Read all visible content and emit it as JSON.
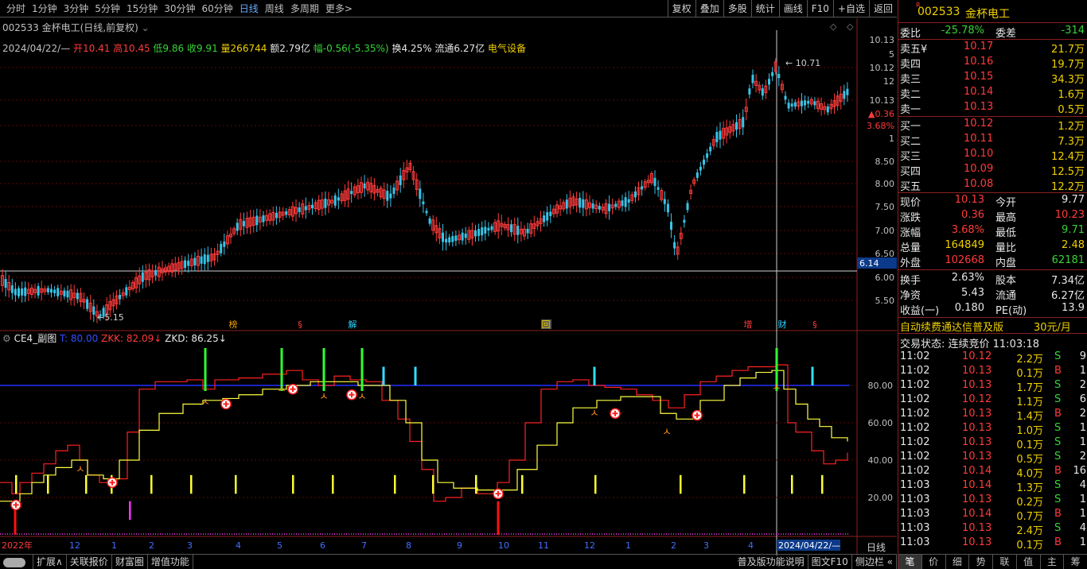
{
  "toolbar": {
    "periods": [
      "分时",
      "1分钟",
      "3分钟",
      "5分钟",
      "15分钟",
      "30分钟",
      "60分钟",
      "日线",
      "周线",
      "多周期",
      "更多>"
    ],
    "active": "日线",
    "right_buttons": [
      "复权",
      "叠加",
      "多股",
      "统计",
      "画线",
      "F10",
      "+自选",
      "返回"
    ]
  },
  "chart": {
    "title": "002533 金杯电工(日线,前复权)",
    "ohlc": {
      "date": "2024/04/22/—",
      "open": "开10.41",
      "high": "高10.45",
      "low": "低9.86",
      "close": "收9.91",
      "vol": "量266744",
      "amt": "额2.79亿",
      "chg": "幅-0.56(-5.35%)",
      "turn": "换4.25%",
      "float": "流通6.27亿",
      "sector": "电气设备"
    },
    "price_labels": [
      "10.13",
      "5",
      "10.12",
      "12",
      "10.13",
      "▲0.36",
      "3.68%",
      "1",
      "8.50",
      "8.00",
      "7.50",
      "7.00",
      "6.50",
      "6.00",
      "5.50"
    ],
    "cross_price": "6.14",
    "high_mark": "10.71",
    "low_mark": "5.15",
    "event_markers": [
      "榜",
      "§",
      "解",
      "回",
      "增",
      "财",
      "§"
    ]
  },
  "indicator": {
    "name": "CE4_副图",
    "t": "T: 80.00",
    "zkk": "ZKK: 82.09↓",
    "zkd": "ZKD: 86.25↓",
    "levels": [
      "80.00",
      "60.00",
      "40.00",
      "20.00"
    ]
  },
  "xaxis": {
    "labels": [
      "2022年",
      "12",
      "1",
      "2",
      "3",
      "4",
      "5",
      "6",
      "7",
      "8",
      "9",
      "10",
      "11",
      "12",
      "1",
      "2",
      "3",
      "4"
    ],
    "cursor_date": "2024/04/22/—",
    "period": "日线"
  },
  "bottom": {
    "tabs": [
      "扩展∧",
      "关联报价",
      "财富圈",
      "增值功能"
    ],
    "right_text": "普及版功能说明",
    "f10": "图文F10",
    "side": "侧边栏 «"
  },
  "quote": {
    "code": "002533",
    "name": "金杯电工",
    "wb": "委比",
    "wb_val": "-25.78%",
    "wc": "委差",
    "wc_val": "-314",
    "sells": [
      {
        "l": "卖五¥",
        "p": "10.17",
        "v": "21.7万"
      },
      {
        "l": "卖四",
        "p": "10.16",
        "v": "19.7万"
      },
      {
        "l": "卖三",
        "p": "10.15",
        "v": "34.3万"
      },
      {
        "l": "卖二",
        "p": "10.14",
        "v": "1.6万"
      },
      {
        "l": "卖一",
        "p": "10.13",
        "v": "0.5万"
      }
    ],
    "buys": [
      {
        "l": "买一",
        "p": "10.12",
        "v": "1.2万"
      },
      {
        "l": "买二",
        "p": "10.11",
        "v": "7.3万"
      },
      {
        "l": "买三",
        "p": "10.10",
        "v": "12.4万"
      },
      {
        "l": "买四",
        "p": "10.09",
        "v": "12.5万"
      },
      {
        "l": "买五",
        "p": "10.08",
        "v": "12.2万"
      }
    ],
    "stats": [
      [
        "现价",
        "10.13",
        "今开",
        "9.77"
      ],
      [
        "涨跌",
        "0.36",
        "最高",
        "10.23"
      ],
      [
        "涨幅",
        "3.68%",
        "最低",
        "9.71"
      ],
      [
        "总量",
        "164849",
        "量比",
        "2.48"
      ],
      [
        "外盘",
        "102668",
        "内盘",
        "62181"
      ]
    ],
    "stats2": [
      [
        "换手",
        "2.63%",
        "股本",
        "7.34亿"
      ],
      [
        "净资",
        "5.43",
        "流通",
        "6.27亿"
      ],
      [
        "收益(一)",
        "0.180",
        "PE(动)",
        "13.9"
      ]
    ],
    "promo": "自动续费通达信普及版",
    "price": "30元/月",
    "status": "交易状态: 连续竞价 11:03:18",
    "ticks": [
      [
        "11:02",
        "10.12",
        "2.2万",
        "S",
        "9"
      ],
      [
        "11:02",
        "10.13",
        "0.1万",
        "B",
        "1"
      ],
      [
        "11:02",
        "10.13",
        "1.7万",
        "S",
        "2"
      ],
      [
        "11:02",
        "10.12",
        "1.1万",
        "S",
        "6"
      ],
      [
        "11:02",
        "10.13",
        "1.4万",
        "B",
        "2"
      ],
      [
        "11:02",
        "10.13",
        "1.0万",
        "S",
        "1"
      ],
      [
        "11:02",
        "10.13",
        "0.1万",
        "S",
        "1"
      ],
      [
        "11:02",
        "10.13",
        "0.5万",
        "S",
        "2"
      ],
      [
        "11:02",
        "10.14",
        "4.0万",
        "B",
        "16"
      ],
      [
        "11:03",
        "10.14",
        "1.3万",
        "S",
        "4"
      ],
      [
        "11:03",
        "10.13",
        "0.2万",
        "S",
        "1"
      ],
      [
        "11:03",
        "10.14",
        "0.7万",
        "B",
        "1"
      ],
      [
        "11:03",
        "10.13",
        "2.4万",
        "S",
        "4"
      ],
      [
        "11:03",
        "10.13",
        "0.1万",
        "B",
        "1"
      ]
    ],
    "tabs": [
      "笔",
      "价",
      "细",
      "势",
      "联",
      "值",
      "主",
      "筹"
    ]
  }
}
